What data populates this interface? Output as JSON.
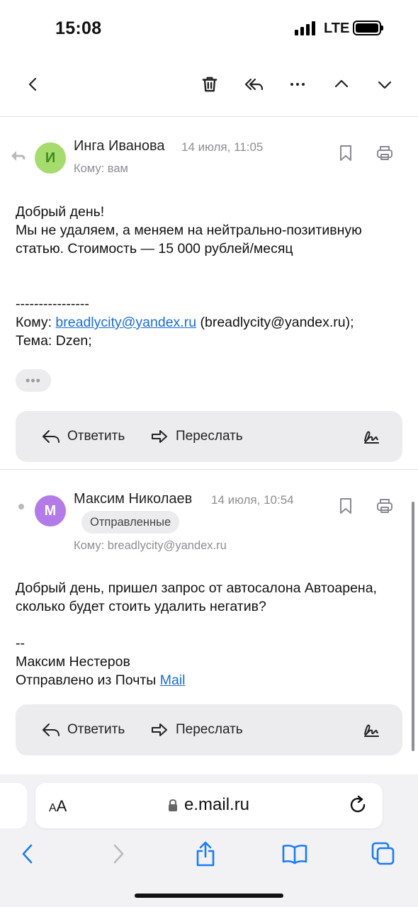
{
  "status_bar": {
    "time": "15:08",
    "network": "LTE",
    "battery_level": 1.0
  },
  "toolbar": {
    "back_icon": "chevron-left-icon",
    "delete_icon": "trash-icon",
    "reply_all_icon": "reply-all-icon",
    "more_icon": "more-horizontal-icon",
    "prev_icon": "chevron-up-icon",
    "next_icon": "chevron-down-icon"
  },
  "messages": [
    {
      "avatar_letter": "И",
      "avatar_color": "#a6dc6e",
      "avatar_text_color": "#3f8a1e",
      "sender": "Инга Иванова",
      "date": "14 июля, 11:05",
      "to": "Кому: вам",
      "body": {
        "greeting": "Добрый день!",
        "line2": "Мы не удаляем, а меняем на нейтрально-позитивную",
        "line3": "статью. Стоимость — 15 000 рублей/месяц",
        "separator": "----------------",
        "to_prefix": "Кому: ",
        "to_link": "breadlycity@yandex.ru",
        "to_suffix": " (breadlycity@yandex.ru);",
        "subject": "Тема: Dzen;"
      },
      "more_label": "•••",
      "reply_label": "Ответить",
      "forward_label": "Переслать"
    },
    {
      "avatar_letter": "М",
      "avatar_color": "#b27be8",
      "avatar_text_color": "#ffffff",
      "sender": "Максим Николаев",
      "date": "14 июля, 10:54",
      "folder_badge": "Отправленные",
      "to": "Кому: breadlycity@yandex.ru",
      "body": {
        "line1": "Добрый день, пришел запрос от автосалона Автоарена,",
        "line2": "сколько будет стоить удалить негатив?",
        "sig_dash": "--",
        "sig_name": "Максим Нестеров",
        "sent_from_prefix": "Отправлено из Почты ",
        "sent_from_link": "Mail"
      },
      "reply_label": "Ответить",
      "forward_label": "Переслать"
    }
  ],
  "safari": {
    "text_size_label": "AA",
    "domain": "e.mail.ru",
    "nav_icons": [
      "chevron-left-icon",
      "chevron-right-icon",
      "share-icon",
      "bookmarks-icon",
      "tabs-icon"
    ]
  }
}
